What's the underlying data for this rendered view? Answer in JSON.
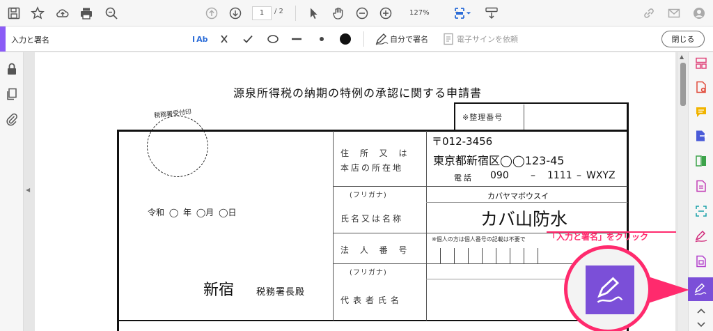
{
  "toolbar": {
    "page_current": "1",
    "page_total": "/ 2",
    "zoom": "127%"
  },
  "signbar": {
    "title": "入力と署名",
    "text_tool_label": "Ab",
    "self_sign_label": "自分で署名",
    "request_esign_label": "電子サインを依頼",
    "close_label": "閉じる"
  },
  "document": {
    "title": "源泉所得税の納期の特例の承認に関する申請書",
    "stamp_label": "税務署受付印",
    "ref_number_label": "※整理番号",
    "date_line": "令和 ◯ 年 ◯月 ◯日",
    "office_name": "新宿",
    "office_suffix": "税務署長殿",
    "address_label_1": "住 所 又 は",
    "address_label_2": "本店の所在地",
    "postal": "〒012-3456",
    "address": "東京都新宿区◯◯123-45",
    "phone_label": "電話",
    "phone_1": "090",
    "phone_dash_1": "–",
    "phone_2": "1111",
    "phone_dash_2": "–",
    "phone_3": "WXYZ",
    "furigana_label": "(フリガナ)",
    "furigana_value": "カバヤマボウスイ",
    "name_label": "氏名又は名称",
    "name_value": "カバ山防水",
    "corp_number_label": "法 人 番 号",
    "corp_number_note": "※個人の方は個人番号の記載は不要で",
    "furigana_label_2": "(フリガナ)",
    "rep_label": "代表者氏名"
  },
  "callout": {
    "text": "「入力と署名」をクリック",
    "color": "#ff2a6d"
  },
  "colors": {
    "accent": "#8b5cf6",
    "active_tile": "#7b4fd8"
  }
}
